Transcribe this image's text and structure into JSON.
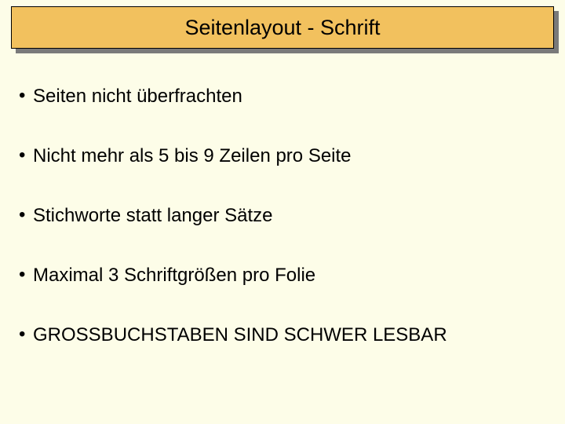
{
  "title": "Seitenlayout - Schrift",
  "bullets": [
    "Seiten nicht überfrachten",
    "Nicht mehr als 5 bis 9 Zeilen pro Seite",
    "Stichworte statt langer Sätze",
    "Maximal 3 Schriftgrößen pro Folie",
    "GROSSBUCHSTABEN SIND SCHWER LESBAR"
  ],
  "colors": {
    "background": "#fdfde8",
    "titleBg": "#f2c15e",
    "shadow": "#7a7a7a"
  }
}
